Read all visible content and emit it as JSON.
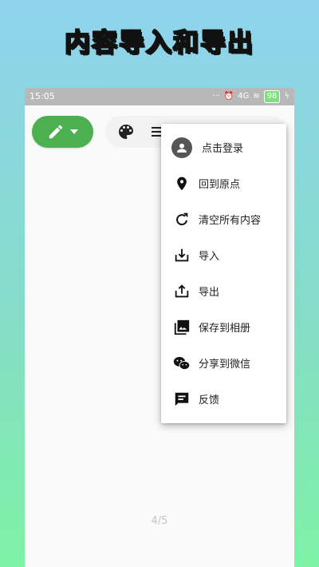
{
  "headline": "内容导入和导出",
  "statusbar": {
    "time": "15:05",
    "dots": "···",
    "alarm": "⏰",
    "signal": "4G",
    "wifi": "≋",
    "battery": "98",
    "charge": "ϟ"
  },
  "canvas": {
    "page_indicator": "4/5"
  },
  "menu": {
    "items": [
      {
        "icon": "user-avatar-icon",
        "label": "点击登录"
      },
      {
        "icon": "location-pin-icon",
        "label": "回到原点"
      },
      {
        "icon": "refresh-icon",
        "label": "清空所有内容"
      },
      {
        "icon": "import-icon",
        "label": "导入"
      },
      {
        "icon": "export-icon",
        "label": "导出"
      },
      {
        "icon": "photo-album-icon",
        "label": "保存到相册"
      },
      {
        "icon": "wechat-icon",
        "label": "分享到微信"
      },
      {
        "icon": "feedback-icon",
        "label": "反馈"
      }
    ]
  },
  "colors": {
    "accent": "#4caf50",
    "statusbar": "#b8b8b8",
    "menu_bg": "#ffffff"
  }
}
